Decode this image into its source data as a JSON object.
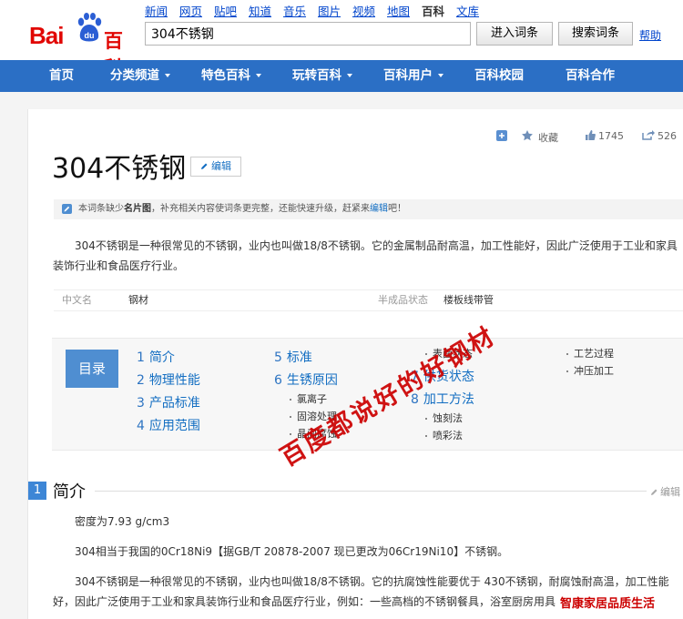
{
  "header": {
    "logo_left": "Bai",
    "logo_right": "百科",
    "nav_links": [
      "新闻",
      "网页",
      "贴吧",
      "知道",
      "音乐",
      "图片",
      "视频",
      "地图",
      "百科",
      "文库"
    ],
    "search_value": "304不锈钢",
    "enter_button": "进入词条",
    "search_button": "搜索词条",
    "help_link": "帮助"
  },
  "mainnav": {
    "items": [
      "首页",
      "分类频道",
      "特色百科",
      "玩转百科",
      "百科用户",
      "百科校园",
      "百科合作"
    ]
  },
  "actions": {
    "collect": "收藏",
    "likes": "1745",
    "shares": "526"
  },
  "article": {
    "title": "304不锈钢",
    "edit_label": "编辑",
    "notice_pre": "本词条缺少",
    "notice_bold": "名片图",
    "notice_mid": "，补充相关内容使词条更完整，还能快速升级，赶紧来",
    "notice_link": "编辑",
    "notice_post": "吧！",
    "summary": "304不锈钢是一种很常见的不锈钢，业内也叫做18/8不锈钢。它的金属制品耐高温，加工性能好，因此广泛使用于工业和家具装饰行业和食品医疗行业。"
  },
  "basic_info": {
    "k1": "中文名",
    "v1": "钢材",
    "k2": "半成品状态",
    "v2": "楼板线带管"
  },
  "toc": {
    "label": "目录",
    "i1": {
      "n": "1",
      "t": "简介"
    },
    "i2": {
      "n": "2",
      "t": "物理性能"
    },
    "i3": {
      "n": "3",
      "t": "产品标准"
    },
    "i4": {
      "n": "4",
      "t": "应用范围"
    },
    "i5": {
      "n": "5",
      "t": "标准"
    },
    "i6": {
      "n": "6",
      "t": "生锈原因"
    },
    "s6a": "氯离子",
    "s6b": "固溶处理",
    "s6c": "晶间腐蚀",
    "s7a": "表面状态",
    "i7": {
      "n": "7",
      "t": "供货状态"
    },
    "i8": {
      "n": "8",
      "t": "加工方法"
    },
    "s8a": "蚀刻法",
    "s8b": "喷彩法",
    "s9a": "工艺过程",
    "s9b": "冲压加工"
  },
  "watermark": "百度都说好的好钢材",
  "section": {
    "num": "1",
    "title": "简介",
    "edit": "编辑",
    "p1": "密度为7.93 g/cm3",
    "p2": "304相当于我国的0Cr18Ni9【据GB/T 20878-2007 现已更改为06Cr19Ni10】不锈钢。",
    "p3": "304不锈钢是一种很常见的不锈钢，业内也叫做18/8不锈钢。它的抗腐蚀性能要优于 430不锈钢，耐腐蚀耐高温，加工性能好，因此广泛使用于工业和家具装饰行业和食品医疗行业，例如：一些高档的不锈钢餐具，浴室厨房用具"
  },
  "bottom_watermark": "智康家居品质生活",
  "colors": {
    "nav_blue": "#2b6fc5",
    "link_blue": "#136ec2",
    "logo_red": "#e10602"
  }
}
